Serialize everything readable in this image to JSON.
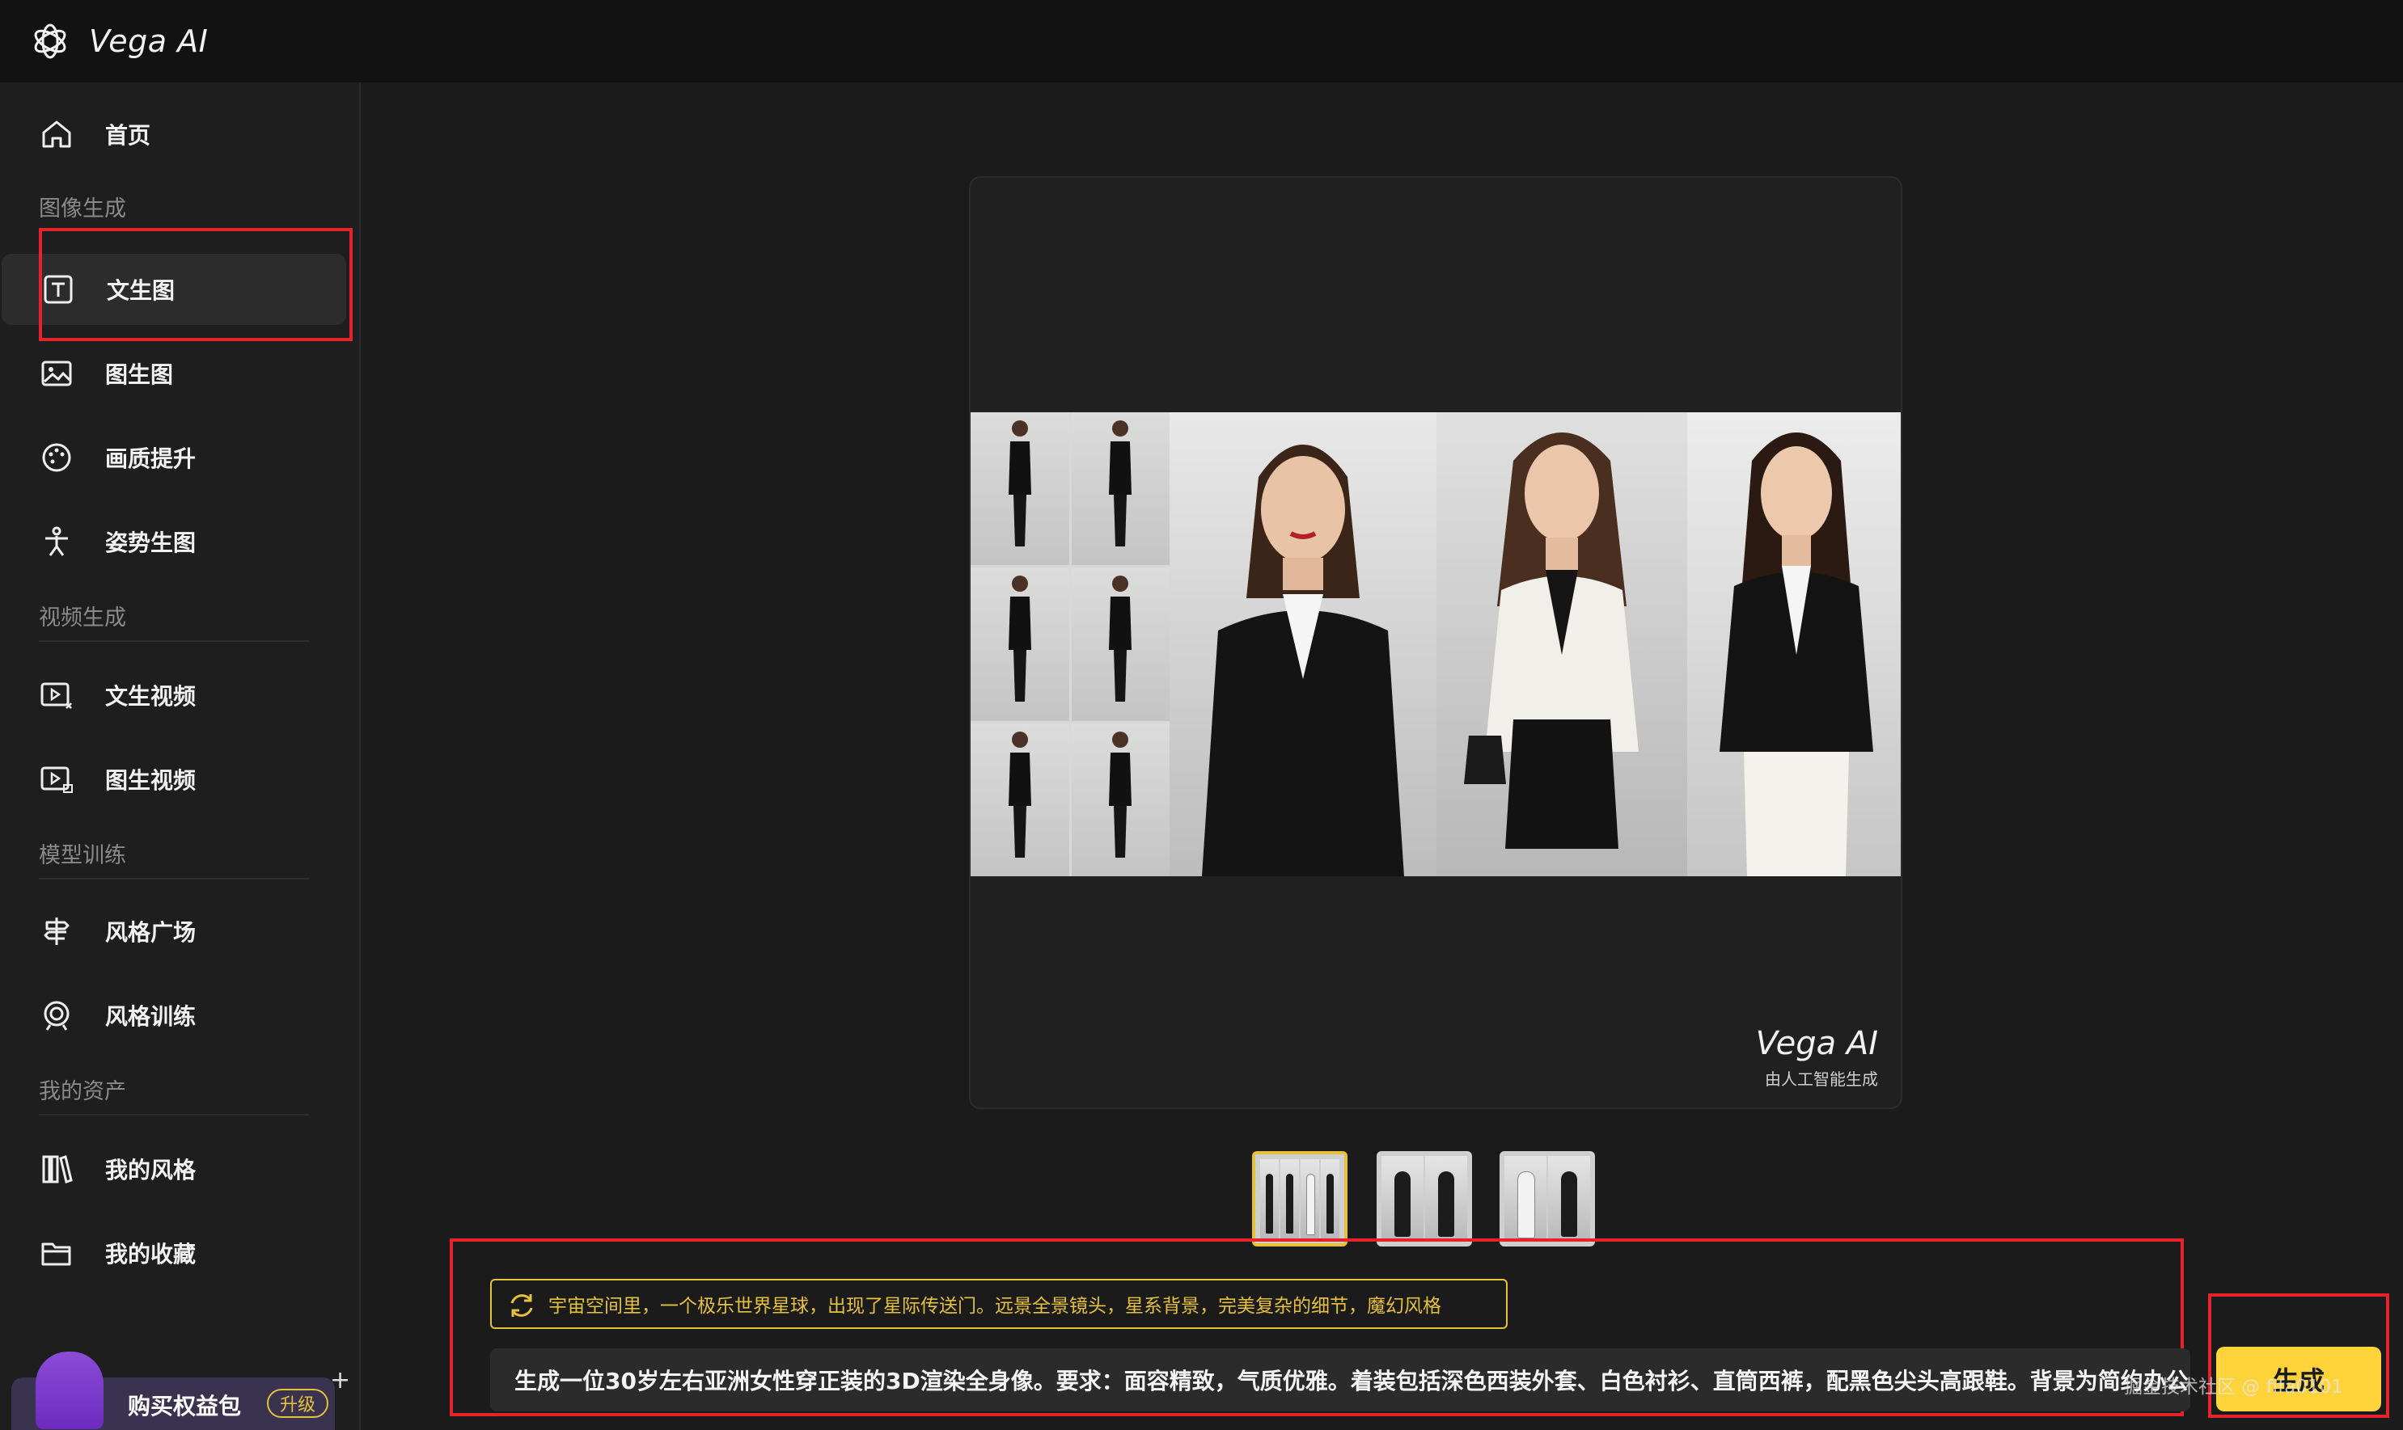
{
  "app": {
    "title": "Vega AI"
  },
  "sidebar": {
    "home": "首页",
    "sections": [
      {
        "label": "图像生成",
        "items": [
          "文生图",
          "图生图",
          "画质提升",
          "姿势生图"
        ]
      },
      {
        "label": "视频生成",
        "items": [
          "文生视频",
          "图生视频"
        ]
      },
      {
        "label": "模型训练",
        "items": [
          "风格广场",
          "风格训练"
        ]
      },
      {
        "label": "我的资产",
        "items": [
          "我的风格",
          "我的收藏"
        ]
      }
    ],
    "active_item": "文生图",
    "upgrade": {
      "label": "购买权益包",
      "badge": "升级"
    }
  },
  "preview": {
    "watermark_title": "Vega AI",
    "watermark_sub": "由人工智能生成"
  },
  "thumbnails": {
    "count": 3,
    "selected_index": 0
  },
  "prompt": {
    "suggestion": "宇宙空间里，一个极乐世界星球，出现了星际传送门。远景全景镜头，星系背景，完美复杂的细节，魔幻风格",
    "text": "生成一位30岁左右亚洲女性穿正装的3D渲染全身像。要求：面容精致，气质优雅。着装包括深色西装外套、白色衬衫、直筒西裤，配黑色尖头高跟鞋。背景为简约办公",
    "generate_label": "生成"
  },
  "corner_watermark": "掘金技术社区 @ fifa0101",
  "colors": {
    "accent": "#ffd43b",
    "highlight": "#e5232b"
  }
}
